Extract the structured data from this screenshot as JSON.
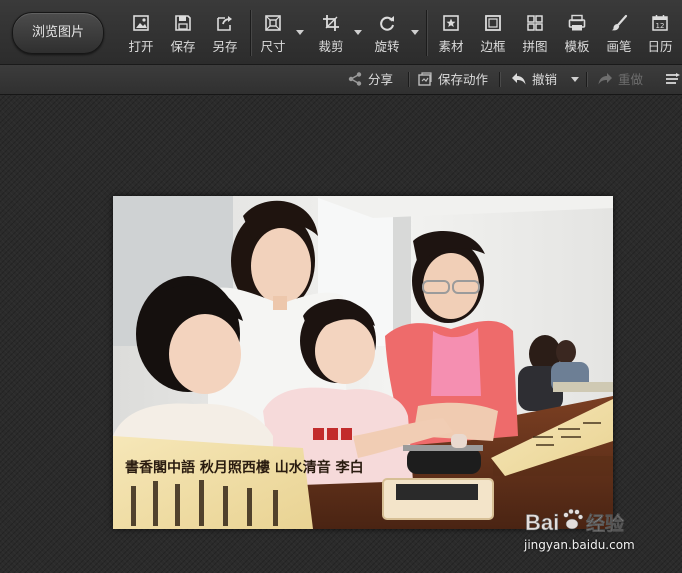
{
  "toolbar": {
    "browse_label": "浏览图片",
    "tools": [
      {
        "id": "open",
        "label": "打开",
        "icon": "open-image-icon"
      },
      {
        "id": "save",
        "label": "保存",
        "icon": "save-icon"
      },
      {
        "id": "save-as",
        "label": "另存",
        "icon": "save-as-icon"
      },
      {
        "id": "size",
        "label": "尺寸",
        "icon": "resize-icon"
      },
      {
        "id": "crop",
        "label": "裁剪",
        "icon": "crop-icon"
      },
      {
        "id": "rotate",
        "label": "旋转",
        "icon": "rotate-icon"
      },
      {
        "id": "material",
        "label": "素材",
        "icon": "star-material-icon"
      },
      {
        "id": "border",
        "label": "边框",
        "icon": "border-icon"
      },
      {
        "id": "collage",
        "label": "拼图",
        "icon": "collage-grid-icon"
      },
      {
        "id": "template",
        "label": "模板",
        "icon": "template-icon"
      },
      {
        "id": "brush",
        "label": "画笔",
        "icon": "brush-icon"
      },
      {
        "id": "calendar",
        "label": "日历",
        "icon": "calendar-icon"
      }
    ]
  },
  "actionbar": {
    "share": "分享",
    "save_action": "保存动作",
    "undo": "撤销",
    "redo": "重做",
    "redo_enabled": false
  },
  "canvas": {
    "scroll_text": "書香閣中語 秋月照西樓 山水清音 李白",
    "watermark_brand": "Bai",
    "watermark_brand_suffix": "经验",
    "watermark_url": "jingyan.baidu.com"
  },
  "colors": {
    "toolbar_bg": "#333333",
    "icon": "#dcdcdc",
    "text": "#dcdcdc",
    "disabled": "#6e6e6e"
  },
  "calendar_icon_day": "12"
}
